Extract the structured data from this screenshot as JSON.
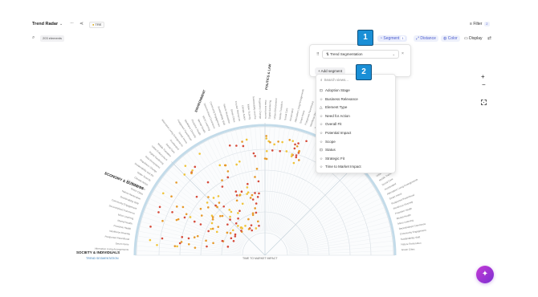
{
  "header": {
    "title": "Trend Radar",
    "title_caret": "⌄",
    "more_icon": "···",
    "share_icon": "⋖",
    "tag": "TRE",
    "filter_label": "Filter",
    "filter_count": "2"
  },
  "subbar": {
    "search_icon": "⌕",
    "element_count": "203 elements"
  },
  "toolbar": {
    "segment_label": "Segment",
    "segment_count": "1",
    "distance_label": "Distance",
    "color_label": "Color",
    "display_label": "Display",
    "swap_icon": "⇄"
  },
  "segment_panel": {
    "handle": "⠿",
    "selected": "Trend Segmentation",
    "selected_icon": "⇅",
    "caret": "⌄",
    "remove": "×",
    "add_label": "Add segment",
    "add_icon": "+"
  },
  "dropdown": {
    "placeholder": "Search views...",
    "items": [
      {
        "icon": "⊡",
        "label": "Adoption Stage"
      },
      {
        "icon": "☆",
        "label": "Business Relevance"
      },
      {
        "icon": "△",
        "label": "Element Type"
      },
      {
        "icon": "☆",
        "label": "Need for Action"
      },
      {
        "icon": "☆",
        "label": "Overall Fit"
      },
      {
        "icon": "☆",
        "label": "Potential Impact"
      },
      {
        "icon": "☆",
        "label": "Scope"
      },
      {
        "icon": "⊡",
        "label": "Status"
      },
      {
        "icon": "☆",
        "label": "Strategic Fit"
      },
      {
        "icon": "☆",
        "label": "Time to Market Impact"
      }
    ]
  },
  "radar": {
    "segments": [
      "ENVIRONMENT",
      "POLITICS & LAW",
      "ECONOMY & BUSINESS",
      "SOCIETY & INDIVIDUALS"
    ],
    "segment_axis_label": "TREND SEGMENTATION",
    "distance_axis_label": "TIME TO MARKET IMPACT",
    "left_labels": [
      "Alternative Living Arrangements",
      "Smart Home",
      "Postponed Parenthood",
      "Workforce Diversity",
      "Proactive Health",
      "Mental Health",
      "Micro Learning",
      "Decentralised Commerce"
    ],
    "right_labels": [
      "Digital Gardening",
      "Urban Enforcement",
      "Mobile Transition",
      "Social Care",
      "Accelerated"
    ],
    "top_labels": [
      "Community Engagement",
      "Sustainability Shift",
      "Nature Restoration",
      "Green Cities",
      "Circular Resources",
      "Climate Action",
      "Water Scarcity",
      "Sustainability and the",
      "Regulatory Change",
      "Data Ecosystems"
    ],
    "colors": {
      "ring": "#d6dde3",
      "dot_orange": "#e79a2a",
      "dot_red": "#d64b3a",
      "dot_yellow": "#f0c43a",
      "band_blue": "#a9cce0"
    }
  },
  "controls": {
    "zoom_in": "+",
    "zoom_out": "−"
  },
  "callouts": [
    "1",
    "2"
  ],
  "fab_icon": "✦"
}
